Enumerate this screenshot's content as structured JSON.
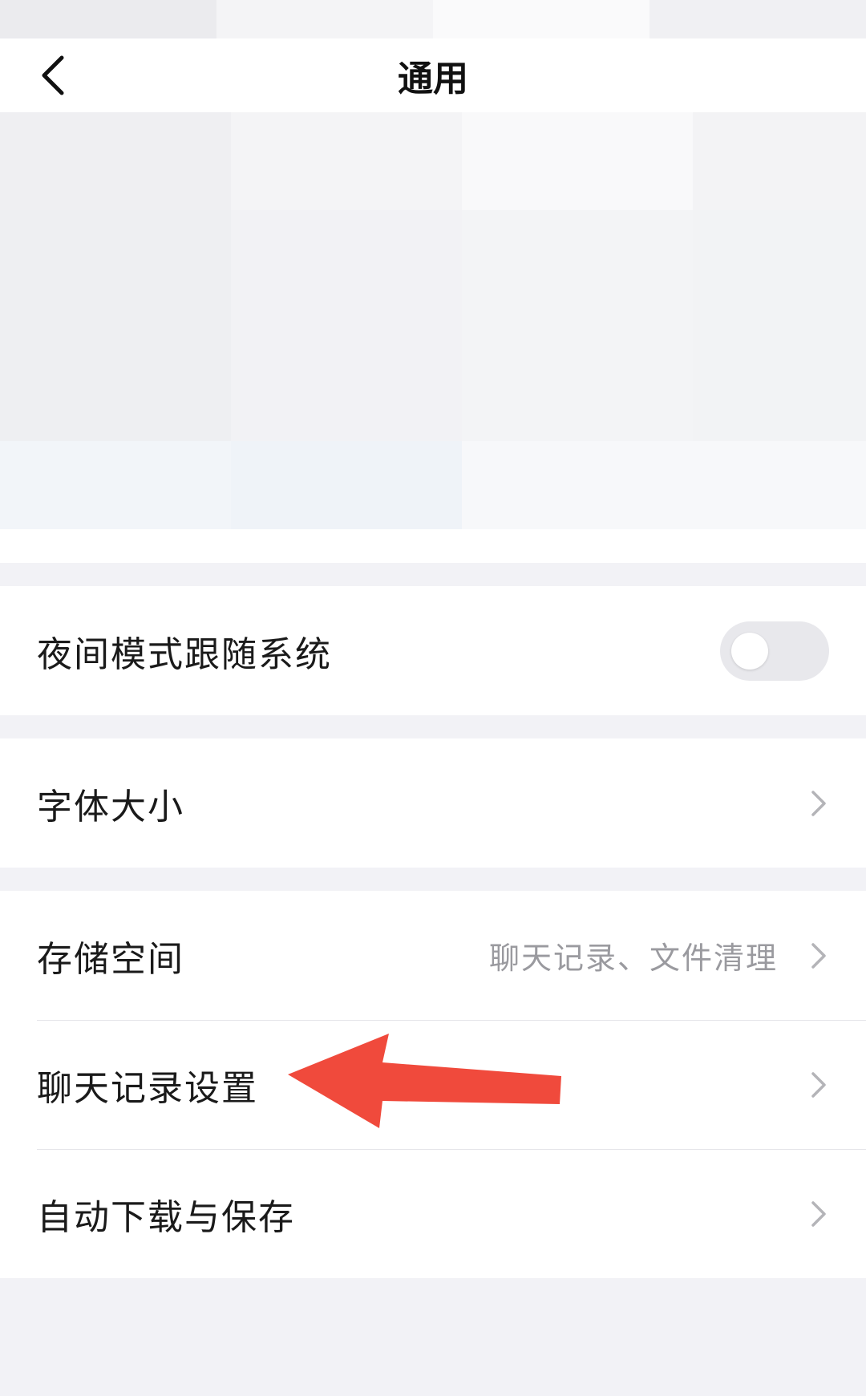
{
  "header": {
    "title": "通用",
    "back_icon": "chevron-left-icon"
  },
  "settings": {
    "night_mode": {
      "label": "夜间模式跟随系统",
      "enabled": false
    },
    "font_size": {
      "label": "字体大小"
    },
    "storage": {
      "label": "存储空间",
      "subtitle": "聊天记录、文件清理"
    },
    "chat_history": {
      "label": "聊天记录设置"
    },
    "auto_download": {
      "label": "自动下载与保存"
    }
  },
  "annotation": {
    "icon": "red-arrow-icon",
    "color": "#f04a3c"
  },
  "colors": {
    "background": "#f2f2f6",
    "card": "#ffffff",
    "secondary_text": "#9a9a9f"
  }
}
